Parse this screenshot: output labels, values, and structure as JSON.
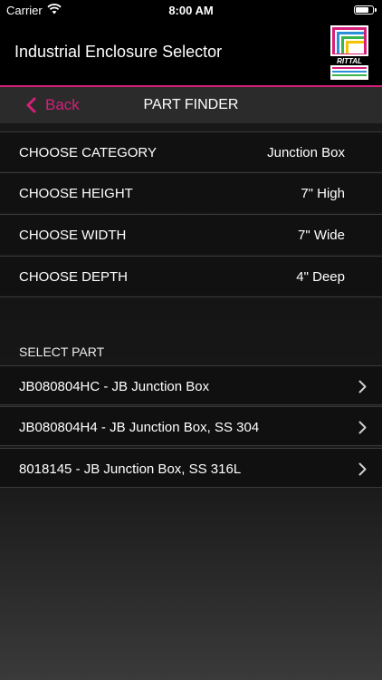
{
  "status_bar": {
    "carrier": "Carrier",
    "time": "8:00 AM"
  },
  "app": {
    "title": "Industrial Enclosure Selector",
    "logo_text": "RITTAL"
  },
  "nav": {
    "back_label": "Back",
    "title": "PART FINDER"
  },
  "options": [
    {
      "label": "CHOOSE CATEGORY",
      "value": "Junction Box"
    },
    {
      "label": "CHOOSE HEIGHT",
      "value": "7\" High"
    },
    {
      "label": "CHOOSE WIDTH",
      "value": "7\" Wide"
    },
    {
      "label": "CHOOSE DEPTH",
      "value": "4\" Deep"
    }
  ],
  "parts_section": {
    "header": "SELECT PART",
    "items": [
      {
        "label": "JB080804HC - JB Junction Box"
      },
      {
        "label": "JB080804H4 - JB Junction Box, SS 304"
      },
      {
        "label": "8018145 - JB Junction Box, SS 316L"
      }
    ]
  },
  "colors": {
    "accent": "#d61f7a",
    "background": "#151515"
  }
}
